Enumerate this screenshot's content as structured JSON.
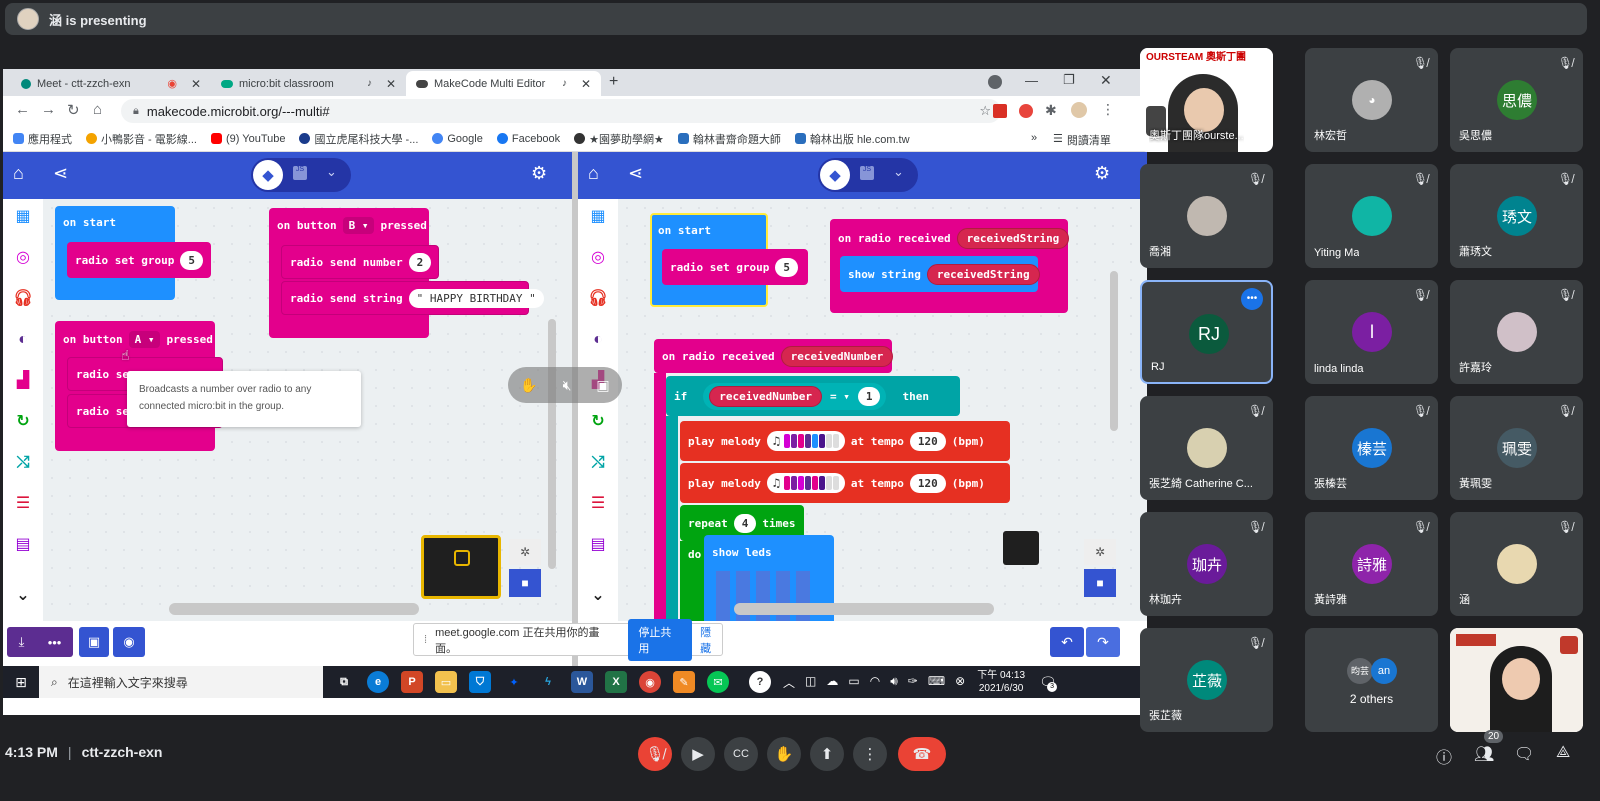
{
  "presenting": {
    "text": "涵 is presenting"
  },
  "browser": {
    "tabs": [
      {
        "label": "Meet - ctt-zzch-exn",
        "color": "#ea4335"
      },
      {
        "label": "micro:bit classroom",
        "color": "#00a884"
      },
      {
        "label": "MakeCode Multi Editor",
        "color": "#444"
      }
    ],
    "new_tab": "+",
    "url": "makecode.microbit.org/---multi#",
    "bookmarks": [
      "應用程式",
      "小鴨影音 - 電影線...",
      "(9) YouTube",
      "國立虎尾科技大學 -...",
      "Google",
      "Facebook",
      "★園夢助學網★",
      "翰林書齋命題大師",
      "翰林出版 hle.com.tw"
    ],
    "reading_list": "閱讀清單",
    "more": "»"
  },
  "left_editor": {
    "on_start": "on start",
    "radio_set_group": "radio set group",
    "group_value": "5",
    "on_button_b": "on button",
    "button_b": "B",
    "pressed": "pressed",
    "radio_send_number": "radio send number",
    "number_value": "2",
    "radio_send_string": "radio send string",
    "string_value": "\" HAPPY BIRTHDAY \"",
    "on_button_a": "on button",
    "button_a": "A",
    "radio_send_cut": "radio se",
    "tooltip": "Broadcasts a number over radio to any connected micro:bit in the group."
  },
  "right_editor": {
    "on_start": "on start",
    "radio_set_group": "radio set group",
    "group_value": "5",
    "on_radio_received_str": "on radio received",
    "received_string": "receivedString",
    "show_string": "show string",
    "on_radio_received_num": "on radio received",
    "received_number": "receivedNumber",
    "if": "if",
    "equals": "=",
    "compare_value": "1",
    "then": "then",
    "play_melody": "play melody",
    "at_tempo": "at tempo",
    "tempo_value": "120",
    "bpm": "(bpm)",
    "repeat": "repeat",
    "repeat_value": "4",
    "times": "times",
    "do": "do",
    "show_leds": "show leds"
  },
  "share_notice": {
    "text": "meet.google.com 正在共用你的畫面。",
    "stop": "停止共用",
    "hide": "隱藏"
  },
  "taskbar": {
    "search": "在這裡輸入文字來搜尋",
    "time": "下午 04:13",
    "date": "2021/6/30",
    "badge": "3"
  },
  "participants": [
    {
      "name": "",
      "initials": "",
      "color": "#fff"
    },
    {
      "name": "林宏哲",
      "initials": "",
      "color": "#b0b0b0"
    },
    {
      "name": "吳思儂",
      "initials": "思儂",
      "color": "#2e7d32"
    },
    {
      "name": "喬湘",
      "initials": "",
      "color": "#c0b8b0"
    },
    {
      "name": "Yiting Ma",
      "initials": "",
      "color": "#10b5a5"
    },
    {
      "name": "蕭琇文",
      "initials": "琇文",
      "color": "#00838f"
    },
    {
      "name": "RJ",
      "initials": "RJ",
      "color": "#0b5a3d"
    },
    {
      "name": "linda linda",
      "initials": "l",
      "color": "#7b1fa2"
    },
    {
      "name": "許嘉玲",
      "initials": "",
      "color": "#d0c0c8"
    },
    {
      "name": "張芝綺 Catherine C...",
      "initials": "",
      "color": "#d8d0b0"
    },
    {
      "name": "張榛芸",
      "initials": "榛芸",
      "color": "#1976d2"
    },
    {
      "name": "黃珮雯",
      "initials": "珮雯",
      "color": "#455a64"
    },
    {
      "name": "林珈卉",
      "initials": "珈卉",
      "color": "#6a1b9a"
    },
    {
      "name": "黃詩雅",
      "initials": "詩雅",
      "color": "#8e24aa"
    },
    {
      "name": "涵",
      "initials": "",
      "color": "#e8d8b0"
    },
    {
      "name": "張芷薇",
      "initials": "芷薇",
      "color": "#00897b"
    },
    {
      "name": "2 others",
      "initials": "",
      "color": "#3c4043"
    },
    {
      "name": "",
      "initials": "",
      "color": "#fff"
    }
  ],
  "tile_texts": {
    "ourstream_banner": "OURSTEAM 奧斯丁團",
    "self_label": "奧斯丁團隊ourste...",
    "others_a": "昀芸",
    "others_b": "an"
  },
  "meeting": {
    "time": "4:13 PM",
    "separator": "|",
    "code": "ctt-zzch-exn",
    "people_count": "20"
  },
  "colors": {
    "accent": "#1a73e8",
    "end_call": "#ea4335",
    "makecode_blue": "#3454d1",
    "radio_pink": "#e3008c",
    "radio_red": "#d6264f",
    "music_orange": "#e63022",
    "loops_green": "#00a410",
    "event_blue": "#1e90ff",
    "basic_blue": "#1e90ff"
  }
}
